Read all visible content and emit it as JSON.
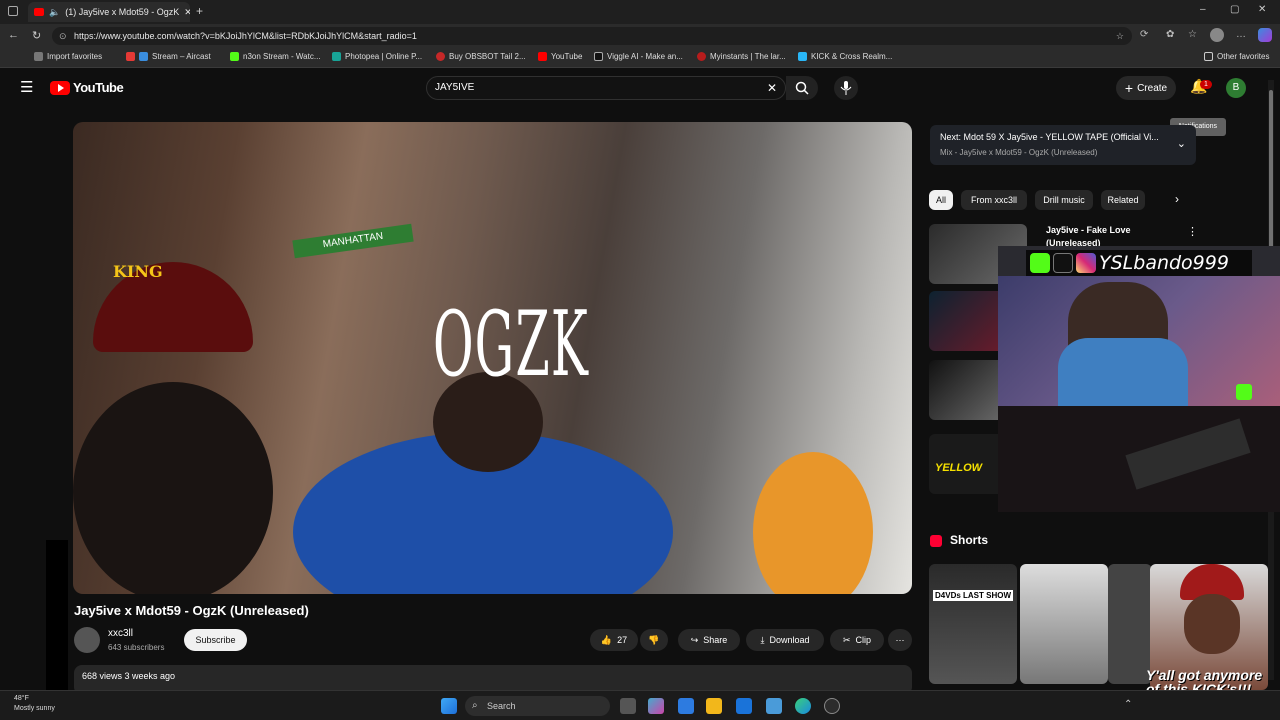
{
  "browser": {
    "tab_title": "(1) Jay5ive x Mdot59 - OgzK",
    "url": "https://www.youtube.com/watch?v=bKJoiJhYlCM&list=RDbKJoiJhYlCM&start_radio=1",
    "bookmarks": [
      "Import favorites",
      "Stream – Aircast",
      "n3on Stream - Watc...",
      "Photopea | Online P...",
      "Buy OBSBOT Tail 2...",
      "YouTube",
      "Viggle AI - Make an...",
      "Myinstants | The lar...",
      "KICK & Cross Realm..."
    ],
    "other_favorites": "Other favorites"
  },
  "youtube": {
    "logo_text": "YouTube",
    "search_value": "JAY5IVE",
    "create_label": "Create",
    "notification_count": "1",
    "avatar_letter": "B",
    "tooltip": "Notifications"
  },
  "video": {
    "overlay_text": "OGZK",
    "title": "Jay5ive x Mdot59 - OgzK (Unreleased)",
    "channel": "xxc3ll",
    "subscribers": "643 subscribers",
    "subscribe_label": "Subscribe",
    "likes": "27",
    "share_label": "Share",
    "download_label": "Download",
    "clip_label": "Clip",
    "views_meta": "668 views  3 weeks ago"
  },
  "sidebar": {
    "next_title": "Next: Mdot 59 X Jay5ive - YELLOW TAPE (Official Vi...",
    "next_sub": "Mix - Jay5ive x Mdot59 - OgzK (Unreleased)",
    "chips": [
      "All",
      "From xxc3ll",
      "Drill music",
      "Related"
    ],
    "rec1_title": "Jay5ive - Fake Love (Unreleased)",
    "yellow_thumb": "YELLOW",
    "shorts_label": "Shorts",
    "short1_caption": "D4VDs LAST SHOW"
  },
  "overlay": {
    "social_handle": "YSLbando999",
    "kick_text": "Y'all got anymore of this KICK's!!!"
  },
  "taskbar": {
    "weather_temp": "48°F",
    "weather_text": "Mostly sunny",
    "search_placeholder": "Search"
  },
  "colors": {
    "youtube_red": "#ff0000",
    "background": "#0f0f0f",
    "chip_active": "#f1f1f1"
  }
}
